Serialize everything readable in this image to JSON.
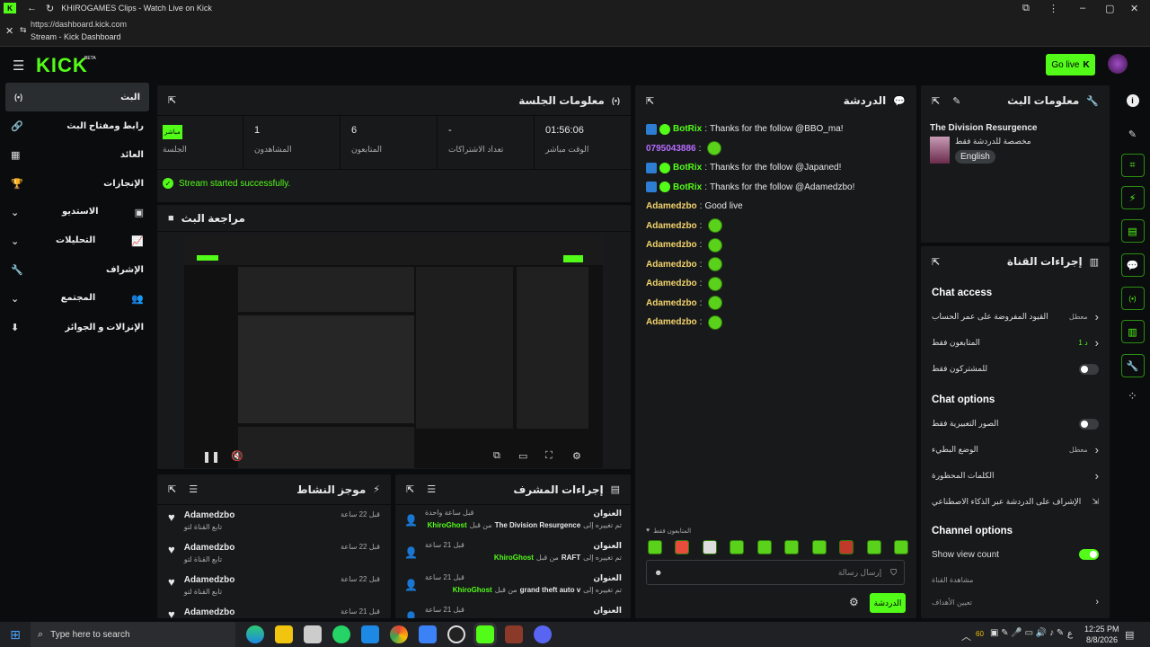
{
  "browser": {
    "title": "KHIROGAMES Clips - Watch Live on Kick",
    "url": "https://dashboard.kick.com",
    "page_title": "Stream - Kick Dashboard"
  },
  "topnav": {
    "logo": "KICK",
    "logo_badge": "BETA",
    "go_live": "Go live"
  },
  "sidebar": {
    "items": [
      {
        "label": "البث"
      },
      {
        "label": "رابط ومفتاح البث"
      },
      {
        "label": "العائد"
      },
      {
        "label": "الإنجازات"
      },
      {
        "label": "الاستديو"
      },
      {
        "label": "التحليلات"
      },
      {
        "label": "الإشراف"
      },
      {
        "label": "المجتمع"
      },
      {
        "label": "الإنزالات و الجوائز"
      }
    ]
  },
  "session": {
    "title": "معلومات الجلسة",
    "stats": [
      {
        "value": "مباشر",
        "label": "الجلسة"
      },
      {
        "value": "1",
        "label": "المشاهدون"
      },
      {
        "value": "6",
        "label": "المتابعون"
      },
      {
        "value": "-",
        "label": "تعداد الاشتراكات"
      },
      {
        "value": "01:56:06",
        "label": "الوقت مباشر"
      }
    ],
    "status": "Stream started successfully."
  },
  "preview": {
    "title": "مراجعة البث"
  },
  "activity": {
    "title": "موجز النشاط",
    "items": [
      {
        "user": "Adamedzbo",
        "time": "قبل 22 ساعة",
        "action": "تابع القناة لتو"
      },
      {
        "user": "Adamedzbo",
        "time": "قبل 22 ساعة",
        "action": "تابع القناة لتو"
      },
      {
        "user": "Adamedzbo",
        "time": "قبل 22 ساعة",
        "action": "تابع القناة لتو"
      },
      {
        "user": "Adamedzbo",
        "time": "قبل 21 ساعة",
        "action": ""
      }
    ]
  },
  "modactions": {
    "title": "إجراءات المشرف",
    "items": [
      {
        "heading": "العنوان",
        "time": "قبل ساعة واحدة",
        "detail": "The Division Resurgence",
        "by": "KhiroGhost"
      },
      {
        "heading": "العنوان",
        "time": "قبل 21 ساعة",
        "detail": "RAFT",
        "by": "KhiroGhost"
      },
      {
        "heading": "العنوان",
        "time": "قبل 21 ساعة",
        "detail": "grand theft auto v",
        "by": "KhiroGhost"
      },
      {
        "heading": "العنوان",
        "time": "قبل 21 ساعة",
        "detail": "",
        "by": ""
      }
    ],
    "changed_by": "من قبل",
    "changed_to": "تم تغييره إلى"
  },
  "chat": {
    "title": "الدردشة",
    "messages": [
      {
        "user": "BotRix",
        "color": "#53fc18",
        "text": "Thanks for the follow @BBO_ma!",
        "bot": true,
        "emotes": 0
      },
      {
        "user": "0795043886",
        "color": "#b76dff",
        "text": "",
        "bot": false,
        "emotes": 1
      },
      {
        "user": "BotRix",
        "color": "#53fc18",
        "text": "Thanks for the follow @Japaned!",
        "bot": true,
        "emotes": 0
      },
      {
        "user": "BotRix",
        "color": "#53fc18",
        "text": "Thanks for the follow @Adamedzbo!",
        "bot": true,
        "emotes": 0
      },
      {
        "user": "Adamedzbo",
        "color": "#f2d36b",
        "text": "Good live",
        "bot": false,
        "emotes": 0
      },
      {
        "user": "Adamedzbo",
        "color": "#f2d36b",
        "text": "",
        "bot": false,
        "emotes": 1
      },
      {
        "user": "Adamedzbo",
        "color": "#f2d36b",
        "text": "",
        "bot": false,
        "emotes": 1
      },
      {
        "user": "Adamedzbo",
        "color": "#f2d36b",
        "text": "",
        "bot": false,
        "emotes": 1
      },
      {
        "user": "Adamedzbo",
        "color": "#f2d36b",
        "text": "",
        "bot": false,
        "emotes": 1
      },
      {
        "user": "Adamedzbo",
        "color": "#f2d36b",
        "text": "",
        "bot": false,
        "emotes": 1
      },
      {
        "user": "Adamedzbo",
        "color": "#f2d36b",
        "text": "",
        "bot": false,
        "emotes": 1
      }
    ],
    "followers_only": "المتابعون فقط",
    "placeholder": "إرسال رسالة",
    "send": "الدردشة"
  },
  "streaminfo": {
    "title": "معلومات البث",
    "game": "The Division Resurgence",
    "category": "مخصصة للدردشة فقط",
    "language": "English"
  },
  "channelactions": {
    "title": "إجراءات القناة",
    "chat_access": "Chat access",
    "access_rows": [
      {
        "label": "القيود المفروضة على عمر الحساب",
        "value": "معطل",
        "type": "arrow"
      },
      {
        "label": "المتابعون فقط",
        "value": "1 د",
        "type": "arrow"
      },
      {
        "label": "للمشتركون فقط",
        "value": "",
        "type": "toggle-off"
      }
    ],
    "chat_options": "Chat options",
    "option_rows": [
      {
        "label": "الصور التعبيرية فقط",
        "value": "",
        "type": "toggle-off"
      },
      {
        "label": "الوضع البطيء",
        "value": "معطل",
        "type": "arrow"
      },
      {
        "label": "الكلمات المحظورة",
        "value": "",
        "type": "arrow"
      },
      {
        "label": "الإشراف على الدردشة عبر الذكاء الاصطناعي",
        "value": "",
        "type": "link"
      }
    ],
    "channel_options": "Channel options",
    "show_view_count": "Show view count",
    "share": "مشاهدة القناة",
    "more": "تعيين الأهداف"
  },
  "taskbar": {
    "search": "Type here to search",
    "time": "12:25 PM",
    "date": "8/8/2026",
    "temp": "60",
    "lang": "ع"
  },
  "colors": {
    "accent": "#53fc18",
    "panel": "#18191b",
    "bg": "#0b0c0d"
  }
}
